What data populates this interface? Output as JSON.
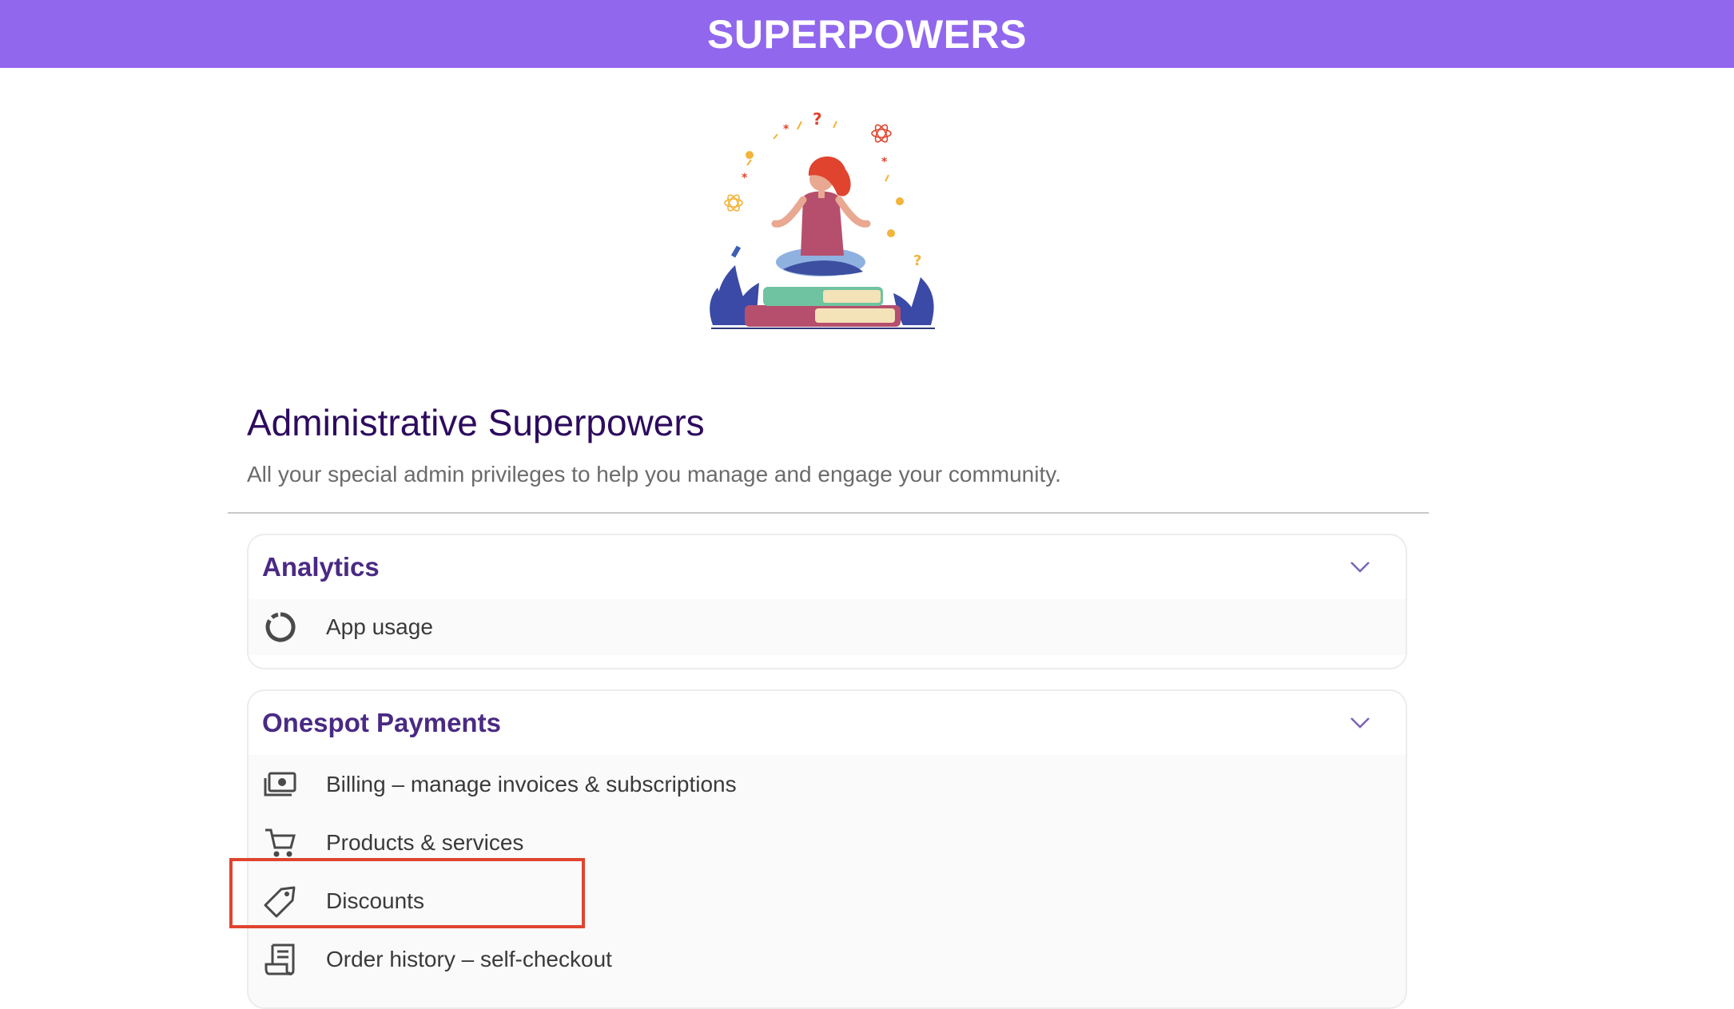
{
  "header": {
    "title": "SUPERPOWERS"
  },
  "page": {
    "title": "Administrative Superpowers",
    "subtitle": "All your special admin privileges to help you manage and engage your community."
  },
  "sections": [
    {
      "title": "Analytics",
      "items": [
        {
          "label": "App usage",
          "icon": "donut-chart-icon"
        }
      ]
    },
    {
      "title": "Onespot Payments",
      "items": [
        {
          "label": "Billing – manage invoices & subscriptions",
          "icon": "money-icon"
        },
        {
          "label": "Products & services",
          "icon": "cart-icon"
        },
        {
          "label": "Discounts",
          "icon": "tag-icon"
        },
        {
          "label": "Order history – self-checkout",
          "icon": "receipt-icon"
        }
      ]
    }
  ],
  "highlighted_item": "Discounts",
  "colors": {
    "topbar": "#9167ee",
    "heading": "#2d0b5e",
    "section_title": "#4a2a84",
    "highlight": "#e0442f"
  }
}
